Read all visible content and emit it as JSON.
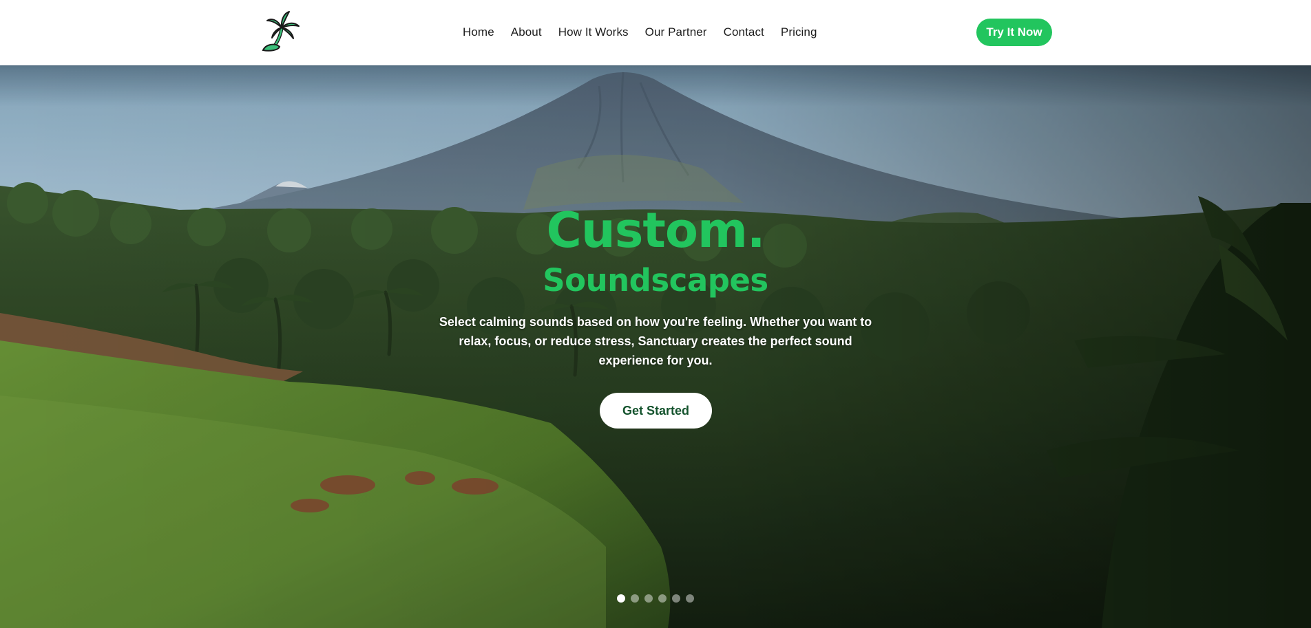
{
  "header": {
    "logo_icon": "palm-tree-icon",
    "nav": [
      "Home",
      "About",
      "How It Works",
      "Our Partner",
      "Contact",
      "Pricing"
    ],
    "cta_label": "Try It Now"
  },
  "hero": {
    "background": "mountain-jungle-landscape",
    "title": "Custom.",
    "subtitle": "Soundscapes",
    "description": "Select calming sounds based on how you're feeling. Whether you want to relax, focus, or reduce stress, Sanctuary creates the perfect sound experience for you.",
    "button_label": "Get Started",
    "slides": 6,
    "active_slide": 1
  },
  "colors": {
    "accent": "#22c55e",
    "button_text": "#14532d",
    "nav_text": "#1c1c1c"
  }
}
